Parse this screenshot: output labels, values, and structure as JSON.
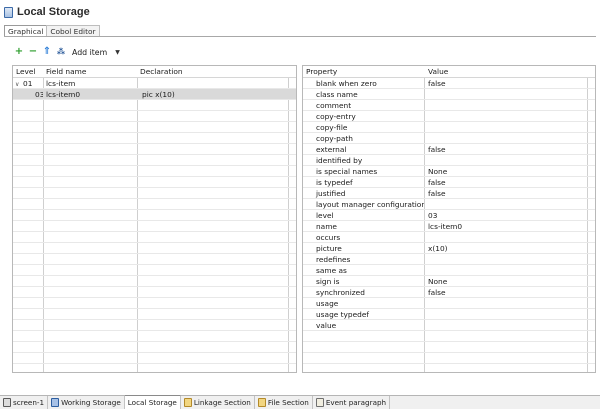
{
  "title": "Local Storage",
  "editor_tabs": [
    {
      "label": "Graphical",
      "active": true
    },
    {
      "label": "Cobol Editor",
      "active": false
    }
  ],
  "toolbar": {
    "add_icon": "plus-icon",
    "remove_icon": "minus-icon",
    "up_icon": "level-up-icon",
    "custom_icon": "add-custom-icon",
    "add_item_label": "Add item",
    "dropdown_icon": "chevron-down-icon"
  },
  "fields": {
    "headers": {
      "level": "Level",
      "field_name": "Field name",
      "declaration": "Declaration"
    },
    "rows": [
      {
        "level": "01",
        "name": "lcs-item",
        "declaration": "",
        "expanded": true,
        "selected": false
      },
      {
        "level": "03",
        "name": "lcs-item0",
        "declaration": "pic x(10)",
        "selected": true
      }
    ]
  },
  "properties": {
    "headers": {
      "property": "Property",
      "value": "Value"
    },
    "rows": [
      {
        "property": "blank when zero",
        "value": "false"
      },
      {
        "property": "class name",
        "value": ""
      },
      {
        "property": "comment",
        "value": ""
      },
      {
        "property": "copy-entry",
        "value": ""
      },
      {
        "property": "copy-file",
        "value": ""
      },
      {
        "property": "copy-path",
        "value": ""
      },
      {
        "property": "external",
        "value": "false"
      },
      {
        "property": "identified by",
        "value": ""
      },
      {
        "property": "is special names",
        "value": "None"
      },
      {
        "property": "is typedef",
        "value": "false"
      },
      {
        "property": "justified",
        "value": "false"
      },
      {
        "property": "layout manager configuration",
        "value": ""
      },
      {
        "property": "level",
        "value": "03"
      },
      {
        "property": "name",
        "value": "lcs-item0"
      },
      {
        "property": "occurs",
        "value": ""
      },
      {
        "property": "picture",
        "value": "x(10)"
      },
      {
        "property": "redefines",
        "value": ""
      },
      {
        "property": "same as",
        "value": ""
      },
      {
        "property": "sign is",
        "value": "None"
      },
      {
        "property": "synchronized",
        "value": "false"
      },
      {
        "property": "usage",
        "value": ""
      },
      {
        "property": "usage typedef",
        "value": ""
      },
      {
        "property": "value",
        "value": ""
      }
    ]
  },
  "bottom_tabs": [
    {
      "label": "screen-1",
      "icon": "screen-icon",
      "active": false
    },
    {
      "label": "Working Storage",
      "icon": "working-storage-icon",
      "active": false
    },
    {
      "label": "Local Storage",
      "icon": "",
      "active": true
    },
    {
      "label": "Linkage Section",
      "icon": "linkage-section-icon",
      "active": false
    },
    {
      "label": "File Section",
      "icon": "file-section-icon",
      "active": false
    },
    {
      "label": "Event paragraph",
      "icon": "event-paragraph-icon",
      "active": false
    }
  ]
}
